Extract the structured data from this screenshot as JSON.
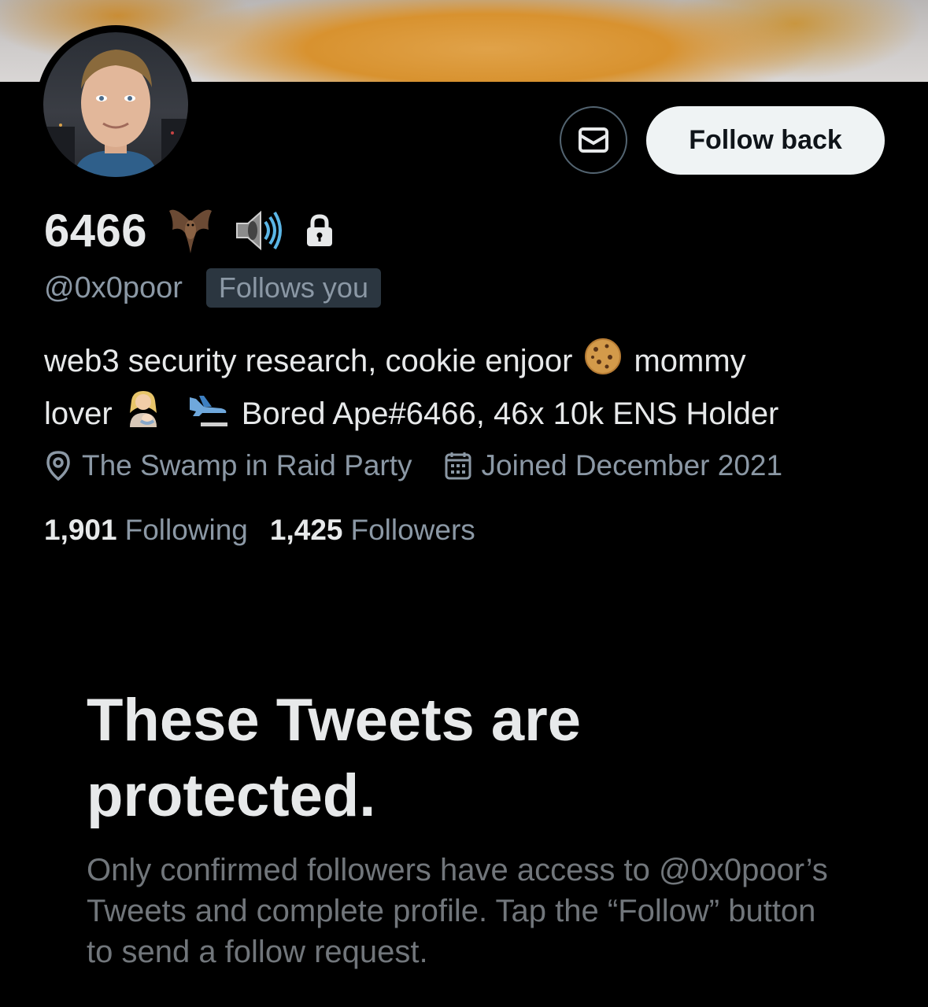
{
  "profile": {
    "display_name": "6466",
    "handle": "@0x0poor",
    "follows_you_badge": "Follows you",
    "name_emojis": [
      "bat-emoji",
      "speaker-emoji",
      "lock-icon"
    ],
    "bio": {
      "part1": "web3 security research, cookie enjoor",
      "part2": "mommy",
      "part3": "lover",
      "part4": "Bored Ape#6466, 46x 10k ENS Holder"
    },
    "location": "The Swamp in Raid Party",
    "joined": "Joined December 2021",
    "following_count": "1,901",
    "following_label": "Following",
    "followers_count": "1,425",
    "followers_label": "Followers"
  },
  "actions": {
    "message_icon": "mail-icon",
    "follow_back_label": "Follow back"
  },
  "protected": {
    "title": "These Tweets are protected.",
    "description": "Only confirmed followers have access to @0x0poor’s Tweets and complete profile. Tap the “Follow” button to send a follow request."
  },
  "colors": {
    "background": "#000000",
    "primary_text": "#e7e9ea",
    "secondary_text": "#8b98a5",
    "muted_text": "#71767b",
    "follow_button_bg": "#eff3f4"
  }
}
